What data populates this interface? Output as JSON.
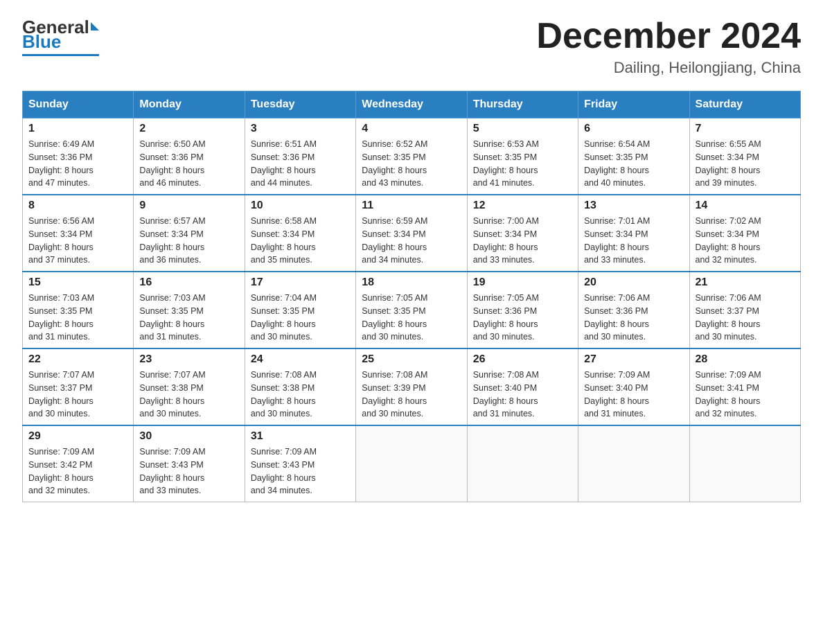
{
  "logo": {
    "general": "General",
    "blue": "Blue"
  },
  "title": "December 2024",
  "subtitle": "Dailing, Heilongjiang, China",
  "days_header": [
    "Sunday",
    "Monday",
    "Tuesday",
    "Wednesday",
    "Thursday",
    "Friday",
    "Saturday"
  ],
  "weeks": [
    [
      {
        "day": "1",
        "sunrise": "6:49 AM",
        "sunset": "3:36 PM",
        "daylight": "8 hours and 47 minutes."
      },
      {
        "day": "2",
        "sunrise": "6:50 AM",
        "sunset": "3:36 PM",
        "daylight": "8 hours and 46 minutes."
      },
      {
        "day": "3",
        "sunrise": "6:51 AM",
        "sunset": "3:36 PM",
        "daylight": "8 hours and 44 minutes."
      },
      {
        "day": "4",
        "sunrise": "6:52 AM",
        "sunset": "3:35 PM",
        "daylight": "8 hours and 43 minutes."
      },
      {
        "day": "5",
        "sunrise": "6:53 AM",
        "sunset": "3:35 PM",
        "daylight": "8 hours and 41 minutes."
      },
      {
        "day": "6",
        "sunrise": "6:54 AM",
        "sunset": "3:35 PM",
        "daylight": "8 hours and 40 minutes."
      },
      {
        "day": "7",
        "sunrise": "6:55 AM",
        "sunset": "3:34 PM",
        "daylight": "8 hours and 39 minutes."
      }
    ],
    [
      {
        "day": "8",
        "sunrise": "6:56 AM",
        "sunset": "3:34 PM",
        "daylight": "8 hours and 37 minutes."
      },
      {
        "day": "9",
        "sunrise": "6:57 AM",
        "sunset": "3:34 PM",
        "daylight": "8 hours and 36 minutes."
      },
      {
        "day": "10",
        "sunrise": "6:58 AM",
        "sunset": "3:34 PM",
        "daylight": "8 hours and 35 minutes."
      },
      {
        "day": "11",
        "sunrise": "6:59 AM",
        "sunset": "3:34 PM",
        "daylight": "8 hours and 34 minutes."
      },
      {
        "day": "12",
        "sunrise": "7:00 AM",
        "sunset": "3:34 PM",
        "daylight": "8 hours and 33 minutes."
      },
      {
        "day": "13",
        "sunrise": "7:01 AM",
        "sunset": "3:34 PM",
        "daylight": "8 hours and 33 minutes."
      },
      {
        "day": "14",
        "sunrise": "7:02 AM",
        "sunset": "3:34 PM",
        "daylight": "8 hours and 32 minutes."
      }
    ],
    [
      {
        "day": "15",
        "sunrise": "7:03 AM",
        "sunset": "3:35 PM",
        "daylight": "8 hours and 31 minutes."
      },
      {
        "day": "16",
        "sunrise": "7:03 AM",
        "sunset": "3:35 PM",
        "daylight": "8 hours and 31 minutes."
      },
      {
        "day": "17",
        "sunrise": "7:04 AM",
        "sunset": "3:35 PM",
        "daylight": "8 hours and 30 minutes."
      },
      {
        "day": "18",
        "sunrise": "7:05 AM",
        "sunset": "3:35 PM",
        "daylight": "8 hours and 30 minutes."
      },
      {
        "day": "19",
        "sunrise": "7:05 AM",
        "sunset": "3:36 PM",
        "daylight": "8 hours and 30 minutes."
      },
      {
        "day": "20",
        "sunrise": "7:06 AM",
        "sunset": "3:36 PM",
        "daylight": "8 hours and 30 minutes."
      },
      {
        "day": "21",
        "sunrise": "7:06 AM",
        "sunset": "3:37 PM",
        "daylight": "8 hours and 30 minutes."
      }
    ],
    [
      {
        "day": "22",
        "sunrise": "7:07 AM",
        "sunset": "3:37 PM",
        "daylight": "8 hours and 30 minutes."
      },
      {
        "day": "23",
        "sunrise": "7:07 AM",
        "sunset": "3:38 PM",
        "daylight": "8 hours and 30 minutes."
      },
      {
        "day": "24",
        "sunrise": "7:08 AM",
        "sunset": "3:38 PM",
        "daylight": "8 hours and 30 minutes."
      },
      {
        "day": "25",
        "sunrise": "7:08 AM",
        "sunset": "3:39 PM",
        "daylight": "8 hours and 30 minutes."
      },
      {
        "day": "26",
        "sunrise": "7:08 AM",
        "sunset": "3:40 PM",
        "daylight": "8 hours and 31 minutes."
      },
      {
        "day": "27",
        "sunrise": "7:09 AM",
        "sunset": "3:40 PM",
        "daylight": "8 hours and 31 minutes."
      },
      {
        "day": "28",
        "sunrise": "7:09 AM",
        "sunset": "3:41 PM",
        "daylight": "8 hours and 32 minutes."
      }
    ],
    [
      {
        "day": "29",
        "sunrise": "7:09 AM",
        "sunset": "3:42 PM",
        "daylight": "8 hours and 32 minutes."
      },
      {
        "day": "30",
        "sunrise": "7:09 AM",
        "sunset": "3:43 PM",
        "daylight": "8 hours and 33 minutes."
      },
      {
        "day": "31",
        "sunrise": "7:09 AM",
        "sunset": "3:43 PM",
        "daylight": "8 hours and 34 minutes."
      },
      null,
      null,
      null,
      null
    ]
  ],
  "labels": {
    "sunrise": "Sunrise:",
    "sunset": "Sunset:",
    "daylight": "Daylight:"
  }
}
